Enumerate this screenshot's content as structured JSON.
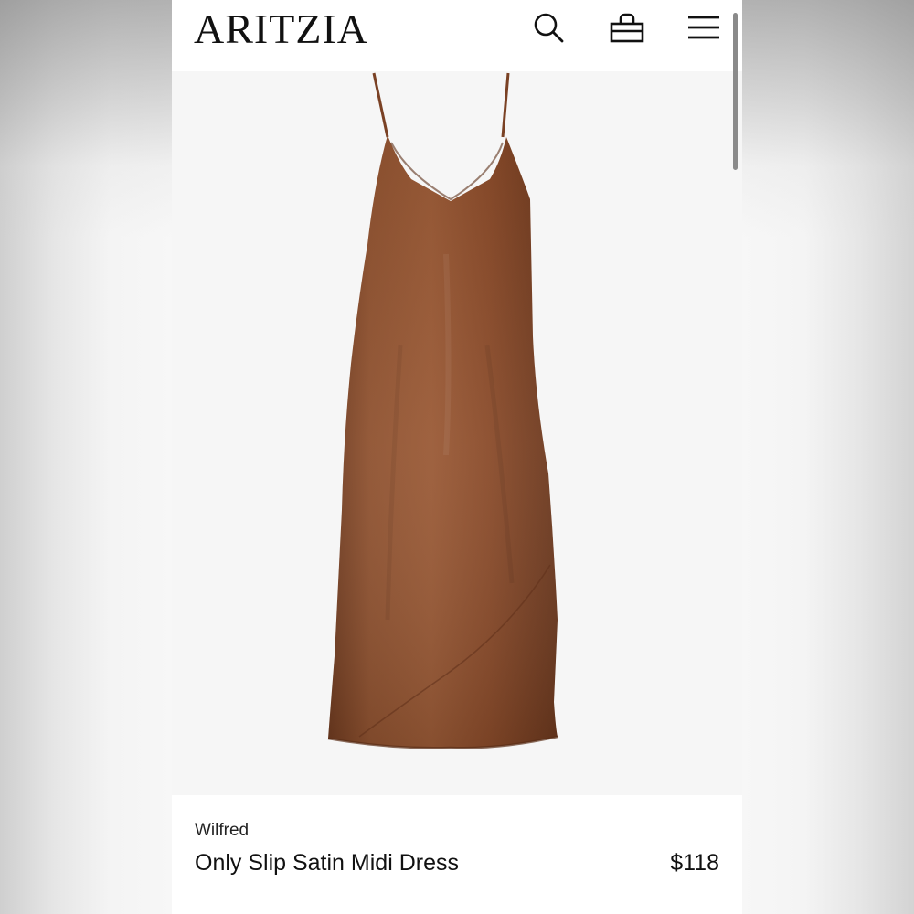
{
  "header": {
    "logo": "ARITZIA",
    "icons": [
      "search-icon",
      "bag-icon",
      "menu-icon"
    ]
  },
  "product": {
    "brand": "Wilfred",
    "name": "Only Slip Satin Midi Dress",
    "price": "$118",
    "color": "#8a4b2a"
  }
}
